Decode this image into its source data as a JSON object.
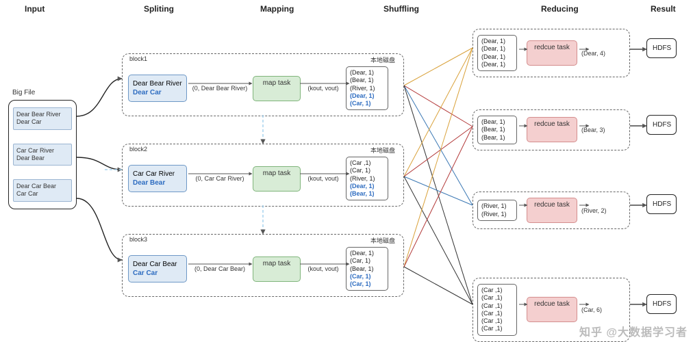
{
  "stages": {
    "input": "Input",
    "splitting": "Spliting",
    "mapping": "Mapping",
    "shuffling": "Shuffling",
    "reducing": "Reducing",
    "result": "Result"
  },
  "input": {
    "big_file_label": "Big File",
    "lines": [
      "Dear Bear River\nDear Car",
      "Car Car River\nDear Bear",
      "Dear Car Bear\nCar Car"
    ]
  },
  "blocks": [
    {
      "label": "block1",
      "split_line1": "Dear Bear River",
      "split_line2": "Dear Car",
      "map_input": "(0, Dear Bear River)",
      "map_task": "map task",
      "kv_label": "(kout, vout)",
      "disk_label": "本地磁盘",
      "kv_out": [
        "(Dear, 1)",
        "(Bear, 1)",
        "(River, 1)"
      ],
      "kv_out_blue": [
        "(Dear, 1)",
        "(Car, 1)"
      ]
    },
    {
      "label": "block2",
      "split_line1": "Car Car River",
      "split_line2": "Dear Bear",
      "map_input": "(0, Car Car River)",
      "map_task": "map task",
      "kv_label": "(kout, vout)",
      "disk_label": "本地磁盘",
      "kv_out": [
        "(Car ,1)",
        "(Car, 1)",
        "(River, 1)"
      ],
      "kv_out_blue": [
        "(Dear, 1)",
        "(Bear, 1)"
      ]
    },
    {
      "label": "block3",
      "split_line1": "Dear Car Bear",
      "split_line2": "Car Car",
      "map_input": "(0, Dear Car Bear)",
      "map_task": "map task",
      "kv_label": "(kout, vout)",
      "disk_label": "本地磁盘",
      "kv_out": [
        "(Dear, 1)",
        "(Car, 1)",
        "(Bear, 1)"
      ],
      "kv_out_blue": [
        "(Car, 1)",
        "(Car, 1)"
      ]
    }
  ],
  "reduces": [
    {
      "kv_in": [
        "(Dear, 1)",
        "(Dear, 1)",
        "(Dear, 1)",
        "(Dear, 1)"
      ],
      "task": "redcue task",
      "out": "(Dear, 4)",
      "result": "HDFS"
    },
    {
      "kv_in": [
        "(Bear, 1)",
        "(Bear, 1)",
        "(Bear, 1)"
      ],
      "task": "redcue task",
      "out": "(Bear, 3)",
      "result": "HDFS"
    },
    {
      "kv_in": [
        "(River, 1)",
        "(River, 1)"
      ],
      "task": "redcue task",
      "out": "(River, 2)",
      "result": "HDFS"
    },
    {
      "kv_in": [
        "(Car ,1)",
        "(Car ,1)",
        "(Car ,1)",
        "(Car ,1)",
        "(Car ,1)",
        "(Car ,1)"
      ],
      "task": "redcue task",
      "out": "(Car, 6)",
      "result": "HDFS"
    }
  ],
  "watermark": "知乎 @大数据学习者"
}
